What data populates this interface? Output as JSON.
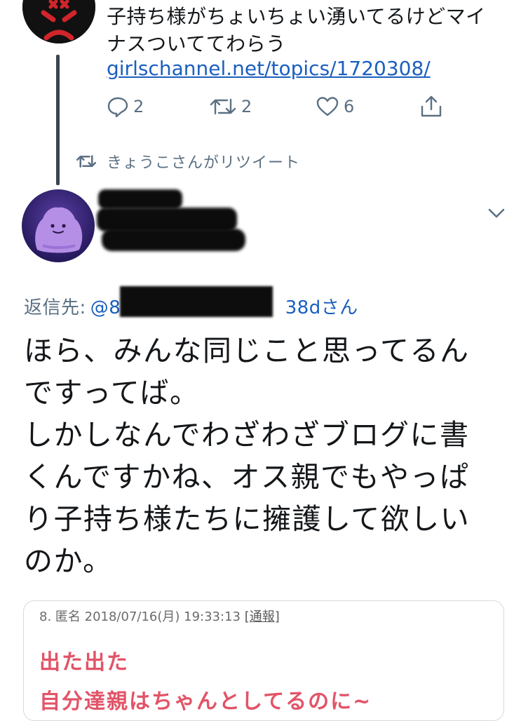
{
  "tweet_top": {
    "text_line1": "子持ち様がちょいちょい湧いてるけどマイ",
    "text_line2": "ナスついててわらう",
    "link": "girlschannel.net/topics/1720308/",
    "reply_count": "2",
    "retweet_count": "2",
    "like_count": "6"
  },
  "retweet_header": {
    "label": "きょうこさんがリツイート"
  },
  "tweet_main": {
    "reply_prefix": "返信先:",
    "reply_handle": "@8Y",
    "reply_handle_tail": "38dさん",
    "lines": [
      "ほら、みんな同じこと思ってるん",
      "ですってば。",
      "しかしなんでわざわざブログに書",
      "くんですかね、オス親でもやっぱ",
      "り子持ち様たちに擁護して欲しい",
      "のか。"
    ]
  },
  "quoted_card": {
    "meta": "8. 匿名 2018/07/16(月) 19:33:13",
    "report": "[通報]",
    "line1": "出た出た",
    "line2": "自分達親はちゃんとしてるのに~"
  },
  "colors": {
    "link": "#1b5fbf",
    "muted": "#5b7083",
    "card_accent": "#e25468",
    "thread_line": "#3a4450"
  }
}
